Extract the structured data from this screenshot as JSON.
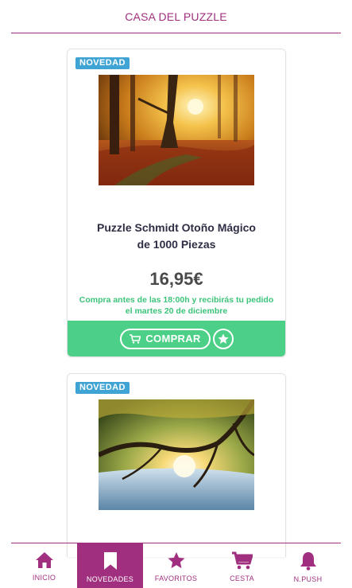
{
  "header": {
    "title": "CASA DEL PUZZLE"
  },
  "products": [
    {
      "badge": "NOVEDAD",
      "image_icon": "autumn-forest-image",
      "title_line1": "Puzzle Schmidt Otoño Mágico",
      "title_line2": "de 1000 Piezas",
      "price": "16,95€",
      "delivery_line1": "Compra antes de las 18:00h y recibirás tu pedido",
      "delivery_line2": "el martes 20 de diciembre",
      "buy_label": "COMPRAR"
    },
    {
      "badge": "NOVEDAD",
      "image_icon": "tree-lake-sunset-image"
    }
  ],
  "tabs": [
    {
      "label": "INICIO",
      "icon": "home-icon",
      "active": false
    },
    {
      "label": "NOVEDADES",
      "icon": "bookmark-icon",
      "active": true
    },
    {
      "label": "FAVORITOS",
      "icon": "star-icon",
      "active": false
    },
    {
      "label": "CESTA",
      "icon": "cart-icon",
      "active": false
    },
    {
      "label": "N.PUSH",
      "icon": "bell-icon",
      "active": false
    }
  ],
  "colors": {
    "brand": "#a0307f",
    "badge": "#3fa3d4",
    "buy_bar": "#4ccf86",
    "delivery_text": "#3cc37a"
  }
}
